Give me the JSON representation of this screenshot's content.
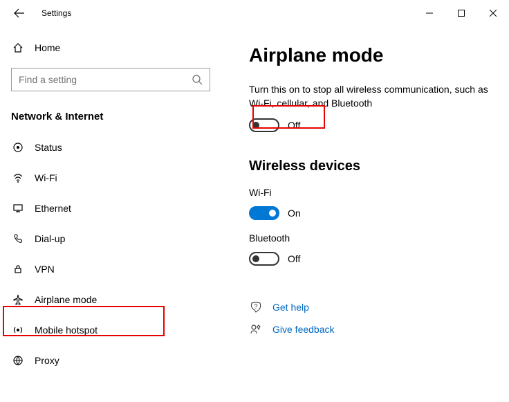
{
  "window": {
    "title": "Settings"
  },
  "sidebar": {
    "home": "Home",
    "search_placeholder": "Find a setting",
    "category": "Network & Internet",
    "items": [
      {
        "label": "Status"
      },
      {
        "label": "Wi-Fi"
      },
      {
        "label": "Ethernet"
      },
      {
        "label": "Dial-up"
      },
      {
        "label": "VPN"
      },
      {
        "label": "Airplane mode"
      },
      {
        "label": "Mobile hotspot"
      },
      {
        "label": "Proxy"
      }
    ]
  },
  "main": {
    "title": "Airplane mode",
    "description": "Turn this on to stop all wireless communication, such as Wi-Fi, cellular, and Bluetooth",
    "airplane_toggle": "Off",
    "section_wireless": "Wireless devices",
    "wifi_label": "Wi-Fi",
    "wifi_toggle": "On",
    "bluetooth_label": "Bluetooth",
    "bluetooth_toggle": "Off",
    "get_help": "Get help",
    "give_feedback": "Give feedback"
  }
}
